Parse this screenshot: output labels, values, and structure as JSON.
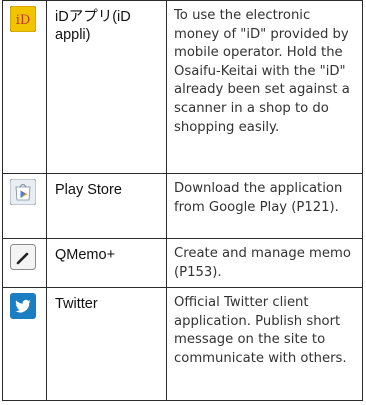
{
  "apps": [
    {
      "icon": "id-app-icon",
      "name": "iDアプリ(iD appli)",
      "description": "To use the electronic money of \"iD\" provided by mobile operator. Hold the Osaifu-Keitai with the \"iD\" already been set against a scanner in a shop to do shopping easily."
    },
    {
      "icon": "play-store-icon",
      "name": "Play Store",
      "description": "Download the application from Google Play (P121)."
    },
    {
      "icon": "qmemo-pencil-icon",
      "name": "QMemo+",
      "description": "Create and manage memo (P153)."
    },
    {
      "icon": "twitter-bird-icon",
      "name": "Twitter",
      "description": "Official Twitter client application. Publish short message on the site to communicate with others."
    }
  ],
  "icon_text": {
    "id_logo": "iD"
  },
  "colors": {
    "id_icon_bg": "#f2c400",
    "id_icon_text": "#c0392b",
    "twitter_bg": "#1b7ec2",
    "play_store_bg": "#e9eef3",
    "qmemo_bg": "#f4f4f4",
    "border": "#2b2b2b"
  }
}
